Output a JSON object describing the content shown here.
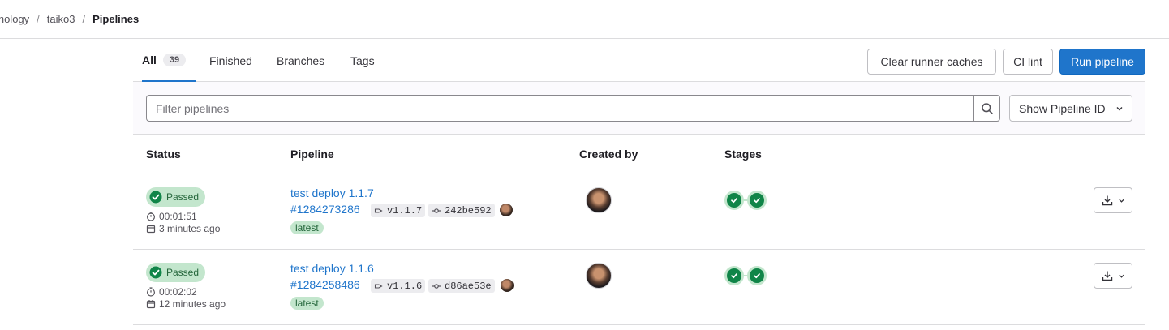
{
  "breadcrumb": {
    "items": [
      "ethology",
      "taiko3",
      "Pipelines"
    ]
  },
  "tabs": [
    {
      "label": "All",
      "count": "39",
      "active": true
    },
    {
      "label": "Finished"
    },
    {
      "label": "Branches"
    },
    {
      "label": "Tags"
    }
  ],
  "actions": {
    "clear_caches": "Clear runner caches",
    "ci_lint": "CI lint",
    "run_pipeline": "Run pipeline"
  },
  "filter": {
    "placeholder": "Filter pipelines",
    "show_id_label": "Show Pipeline ID"
  },
  "table": {
    "headers": [
      "Status",
      "Pipeline",
      "Created by",
      "Stages"
    ],
    "rows": [
      {
        "status": "Passed",
        "duration": "00:01:51",
        "finished": "3 minutes ago",
        "title": "test deploy 1.1.7",
        "pipeline_id": "#1284273286",
        "tag": "v1.1.7",
        "commit": "242be592",
        "label": "latest",
        "stages": [
          "passed",
          "passed"
        ]
      },
      {
        "status": "Passed",
        "duration": "00:02:02",
        "finished": "12 minutes ago",
        "title": "test deploy 1.1.6",
        "pipeline_id": "#1284258486",
        "tag": "v1.1.6",
        "commit": "d86ae53e",
        "label": "latest",
        "stages": [
          "passed",
          "passed"
        ]
      }
    ]
  },
  "colors": {
    "accent": "#1f75cb",
    "success": "#108548",
    "success_bg": "#c3e6cd"
  }
}
